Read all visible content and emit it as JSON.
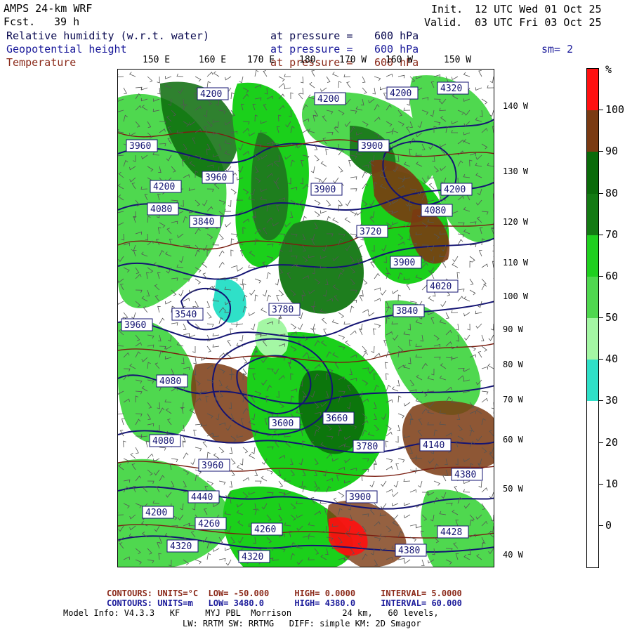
{
  "header": {
    "model_name": "AMPS 24-km WRF",
    "forecast_label": "Fcst.",
    "forecast_hours": "39 h",
    "init_label": "Init.",
    "init_time": "12 UTC Wed 01 Oct 25",
    "valid_label": "Valid.",
    "valid_time": "03 UTC Fri 03 Oct 25",
    "smoothing": "sm= 2"
  },
  "fields": [
    {
      "name": "Relative humidity (w.r.t. water)",
      "level_text": "at pressure =",
      "level_value": "600 hPa",
      "color": "#0a0a50"
    },
    {
      "name": "Geopotential height",
      "level_text": "at pressure =",
      "level_value": "600 hPa",
      "color": "#1a1a9a"
    },
    {
      "name": "Temperature",
      "level_text": "at pressure =",
      "level_value": "600 hPa",
      "color": "#8b2a1a"
    }
  ],
  "map": {
    "lon_labels": [
      "150 E",
      "160 E",
      "170 E",
      "180",
      "170 W",
      "160 W",
      "150 W"
    ],
    "lat_labels": [
      "140 W",
      "130 W",
      "120 W",
      "110 W",
      "100 W",
      "90 W",
      "80 W",
      "70 W",
      "60 W",
      "50 W",
      "40 W"
    ],
    "height_contour_labels": [
      "4200",
      "4320",
      "3960",
      "4080",
      "3840",
      "3900",
      "4140",
      "3720",
      "3780",
      "3660",
      "3600",
      "4380",
      "4260",
      "4440",
      "4020",
      "3540",
      "4428"
    ],
    "colors": {
      "rh_30_40": "#2fe0c8",
      "rh_40_50": "#a4f7a4",
      "rh_50_60": "#4fd84f",
      "rh_60_70": "#1bd01b",
      "rh_70_80": "#0b6b0b",
      "rh_80_90": "#1e7e1e",
      "rh_90_100": "#7a3a12",
      "rh_100": "#ff1010",
      "height_contour": "#141473",
      "temperature_contour": "#7a1f12",
      "wind_barb": "#555555"
    }
  },
  "colorbar": {
    "unit": "%",
    "levels": [
      "100",
      "90",
      "80",
      "70",
      "60",
      "50",
      "40",
      "30",
      "20",
      "10",
      "0"
    ],
    "segments": [
      {
        "color": "#ff1010"
      },
      {
        "color": "#7a3a12"
      },
      {
        "color": "#0a6b0a"
      },
      {
        "color": "#137a13"
      },
      {
        "color": "#1fd01f"
      },
      {
        "color": "#4fd84f"
      },
      {
        "color": "#a4f7a4"
      },
      {
        "color": "#2fe0c8"
      },
      {
        "color": "#ffffff"
      },
      {
        "color": "#ffffff"
      },
      {
        "color": "#ffffff"
      },
      {
        "color": "#ffffff"
      }
    ]
  },
  "footer": {
    "temp_contours": {
      "label": "CONTOURS:",
      "units": "UNITS=°C",
      "low": "LOW= -50.000",
      "high": "HIGH= 0.0000",
      "interval": "INTERVAL= 5.0000"
    },
    "height_contours": {
      "label": "CONTOURS:",
      "units": "UNITS=m",
      "low": "LOW= 3480.0",
      "high": "HIGH= 4380.0",
      "interval": "INTERVAL= 60.000"
    },
    "model_info_1": "Model Info: V4.3.3   KF     MYJ PBL  Morrison          24 km,   60 levels,",
    "model_info_2": "LW: RRTM SW: RRTMG   DIFF: simple KM: 2D Smagor"
  }
}
